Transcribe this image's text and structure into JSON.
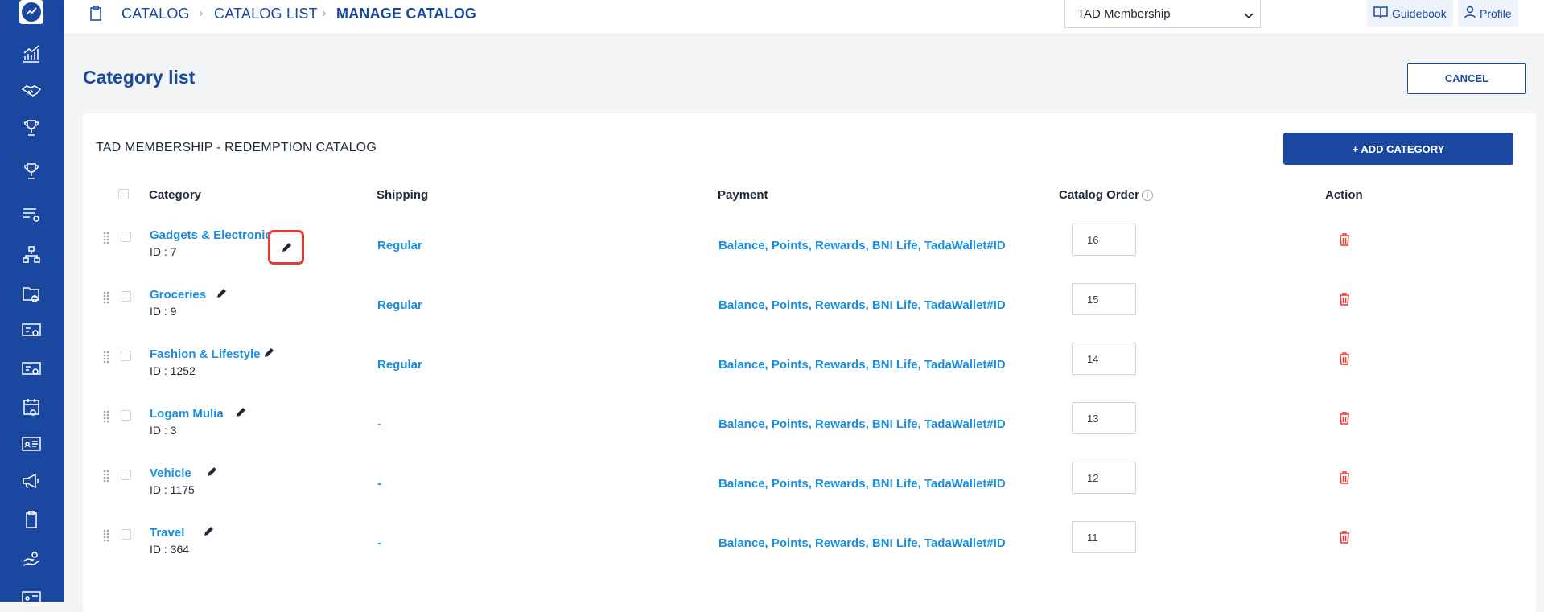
{
  "breadcrumb": [
    "CATALOG",
    "CATALOG LIST",
    "MANAGE CATALOG"
  ],
  "membership_select": {
    "value": "TAD Membership"
  },
  "top_buttons": {
    "guidebook": "Guidebook",
    "profile": "Profile"
  },
  "page": {
    "title": "Category list",
    "cancel_label": "CANCEL"
  },
  "card": {
    "title": "TAD MEMBERSHIP - REDEMPTION CATALOG",
    "add_label": "+ ADD CATEGORY"
  },
  "columns": {
    "category": "Category",
    "shipping": "Shipping",
    "payment": "Payment",
    "order": "Catalog Order",
    "action": "Action"
  },
  "rows": [
    {
      "name": "Gadgets & Electronic",
      "id": "ID : 7",
      "shipping": "Regular",
      "payment": "Balance, Points, Rewards, BNI Life, TadaWallet#ID",
      "order": "16"
    },
    {
      "name": "Groceries",
      "id": "ID : 9",
      "shipping": "Regular",
      "payment": "Balance, Points, Rewards, BNI Life, TadaWallet#ID",
      "order": "15"
    },
    {
      "name": "Fashion & Lifestyle",
      "id": "ID : 1252",
      "shipping": "Regular",
      "payment": "Balance, Points, Rewards, BNI Life, TadaWallet#ID",
      "order": "14"
    },
    {
      "name": "Logam Mulia",
      "id": "ID : 3",
      "shipping": "-",
      "payment": "Balance, Points, Rewards, BNI Life, TadaWallet#ID",
      "order": "13"
    },
    {
      "name": "Vehicle",
      "id": "ID : 1175",
      "shipping": "-",
      "payment": "Balance, Points, Rewards, BNI Life, TadaWallet#ID",
      "order": "12"
    },
    {
      "name": "Travel",
      "id": "ID : 364",
      "shipping": "-",
      "payment": "Balance, Points, Rewards, BNI Life, TadaWallet#ID",
      "order": "11"
    }
  ],
  "colors": {
    "brand": "#1a47a0",
    "link": "#1a8fe0",
    "danger": "#e53935"
  },
  "icons": [
    "dashboard-chart-icon",
    "handshake-icon",
    "trophy-icon",
    "trophy-icon",
    "list-settings-icon",
    "hierarchy-icon",
    "folder-clock-icon",
    "card-settings-icon",
    "card-settings-icon",
    "calendar-settings-icon",
    "id-card-icon",
    "megaphone-icon",
    "clipboard-icon",
    "hand-coin-icon",
    "id-card-icon"
  ]
}
